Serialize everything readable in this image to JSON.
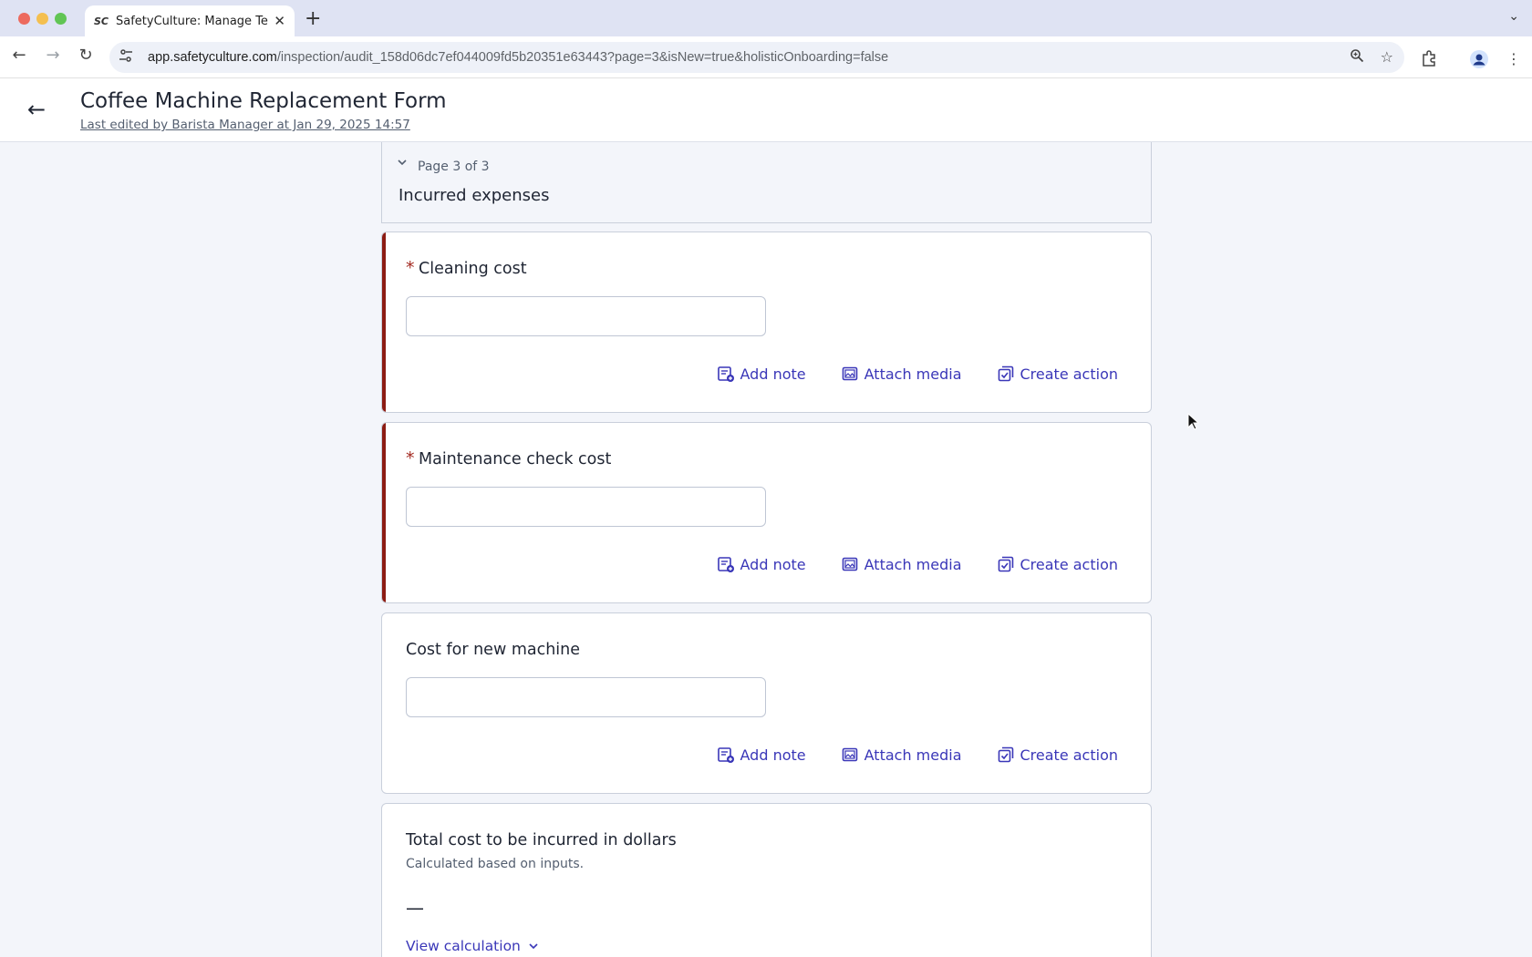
{
  "browser": {
    "tab_title": "SafetyCulture: Manage Teams",
    "tab_favicon": "SC",
    "url_host": "app.safetyculture.com",
    "url_path": "/inspection/audit_158d06dc7ef044009fd5b20351e63443?page=3&isNew=true&holisticOnboarding=false"
  },
  "header": {
    "title": "Coffee Machine Replacement Form",
    "subtitle": "Last edited by Barista Manager at Jan 29, 2025 14:57"
  },
  "page": {
    "indicator": "Page 3 of 3",
    "name": "Incurred expenses"
  },
  "questions": [
    {
      "required_mark": "*",
      "label": "Cleaning cost",
      "value": ""
    },
    {
      "required_mark": "*",
      "label": "Maintenance check cost",
      "value": ""
    },
    {
      "label": "Cost for new machine",
      "value": ""
    }
  ],
  "actions": {
    "add_note": "Add note",
    "attach_media": "Attach media",
    "create_action": "Create action"
  },
  "total": {
    "title": "Total cost to be incurred in dollars",
    "subtitle": "Calculated based on inputs.",
    "value": "—",
    "view_calculation": "View calculation"
  },
  "colors": {
    "accent": "#3a37b8",
    "required": "#8c1c13",
    "background": "#f3f5fa"
  }
}
